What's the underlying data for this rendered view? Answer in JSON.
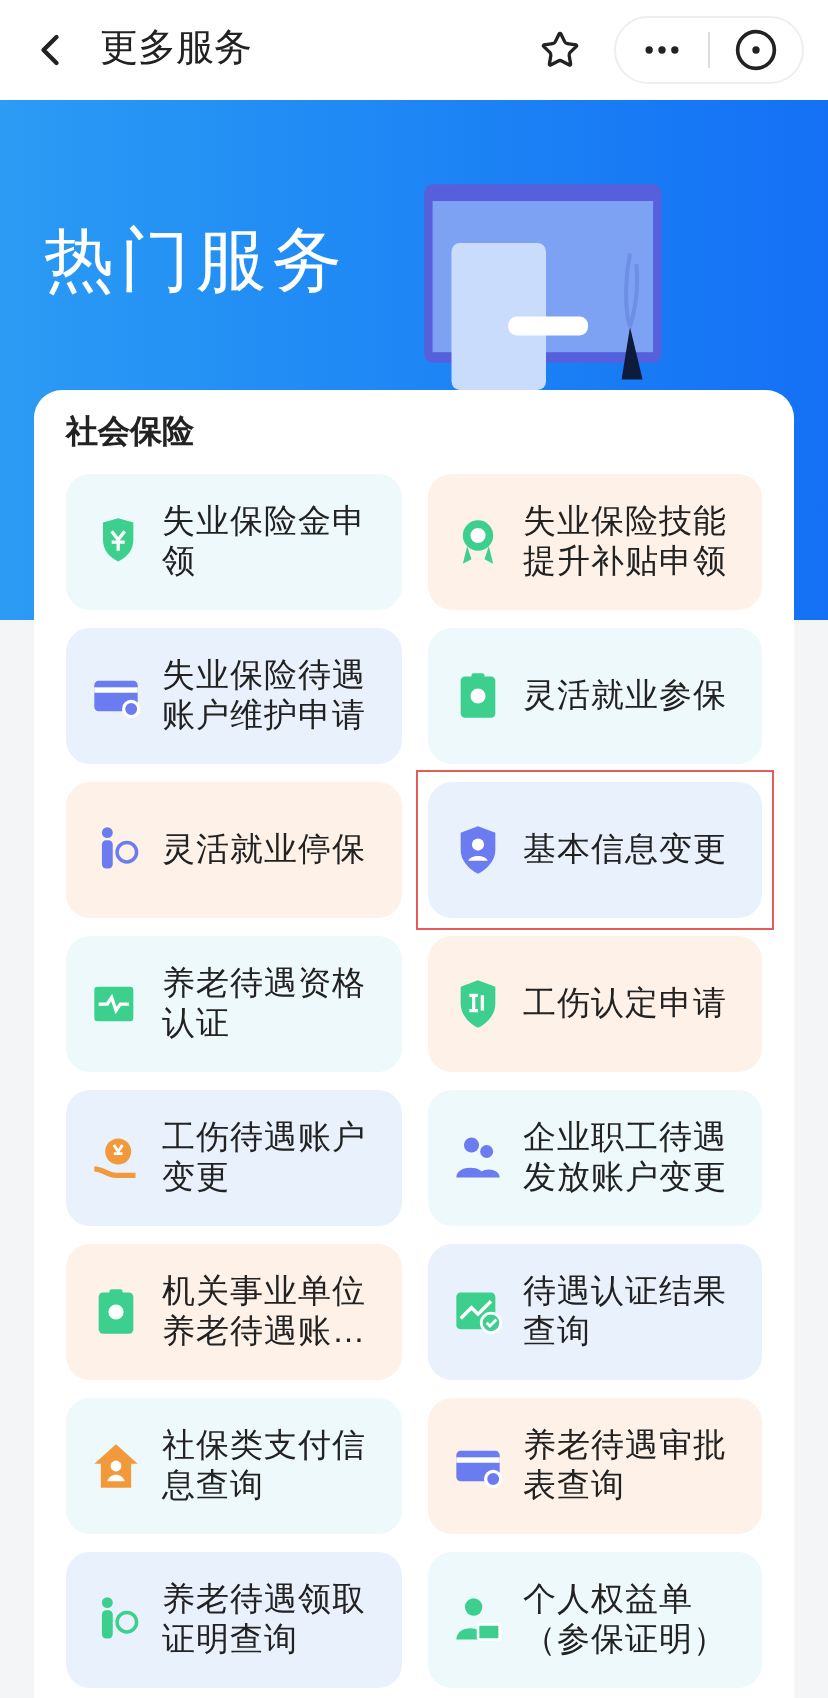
{
  "nav": {
    "title": "更多服务"
  },
  "banner": {
    "title": "热门服务"
  },
  "section": {
    "title": "社会保险",
    "tiles": [
      {
        "lines": [
          "失业保险金申",
          "领"
        ],
        "kind": "cyan",
        "color": "#3ccf8e",
        "selected": false
      },
      {
        "lines": [
          "失业保险技能",
          "提升补贴申领"
        ],
        "kind": "orange",
        "color": "#3ccf8e",
        "selected": false
      },
      {
        "lines": [
          "失业保险待遇",
          "账户维护申请"
        ],
        "kind": "blue",
        "color": "#6b7cf0",
        "selected": false
      },
      {
        "lines": [
          "灵活就业参保"
        ],
        "kind": "cyan",
        "color": "#3ccf8e",
        "selected": false
      },
      {
        "lines": [
          "灵活就业停保"
        ],
        "kind": "orange",
        "color": "#6b7cf0",
        "selected": false
      },
      {
        "lines": [
          "基本信息变更"
        ],
        "kind": "blue",
        "color": "#6b7cf0",
        "selected": true
      },
      {
        "lines": [
          "养老待遇资格",
          "认证"
        ],
        "kind": "cyan",
        "color": "#3ccf8e",
        "selected": false
      },
      {
        "lines": [
          "工伤认定申请"
        ],
        "kind": "orange",
        "color": "#3ccf8e",
        "selected": false
      },
      {
        "lines": [
          "工伤待遇账户",
          "变更"
        ],
        "kind": "blue",
        "color": "#f29a3b",
        "selected": false
      },
      {
        "lines": [
          "企业职工待遇",
          "发放账户变更"
        ],
        "kind": "cyan",
        "color": "#6b7cf0",
        "selected": false
      },
      {
        "lines": [
          "机关事业单位",
          "养老待遇账…"
        ],
        "kind": "orange",
        "color": "#3ccf8e",
        "selected": false
      },
      {
        "lines": [
          "待遇认证结果",
          "查询"
        ],
        "kind": "blue",
        "color": "#3ccf8e",
        "selected": false
      },
      {
        "lines": [
          "社保类支付信",
          "息查询"
        ],
        "kind": "cyan",
        "color": "#f29a3b",
        "selected": false
      },
      {
        "lines": [
          "养老待遇审批",
          "表查询"
        ],
        "kind": "orange",
        "color": "#6b7cf0",
        "selected": false
      },
      {
        "lines": [
          "养老待遇领取",
          "证明查询"
        ],
        "kind": "blue",
        "color": "#3ccf8e",
        "selected": false
      },
      {
        "lines": [
          "个人权益单",
          "（参保证明）"
        ],
        "kind": "cyan",
        "color": "#3ccf8e",
        "selected": false
      }
    ]
  }
}
